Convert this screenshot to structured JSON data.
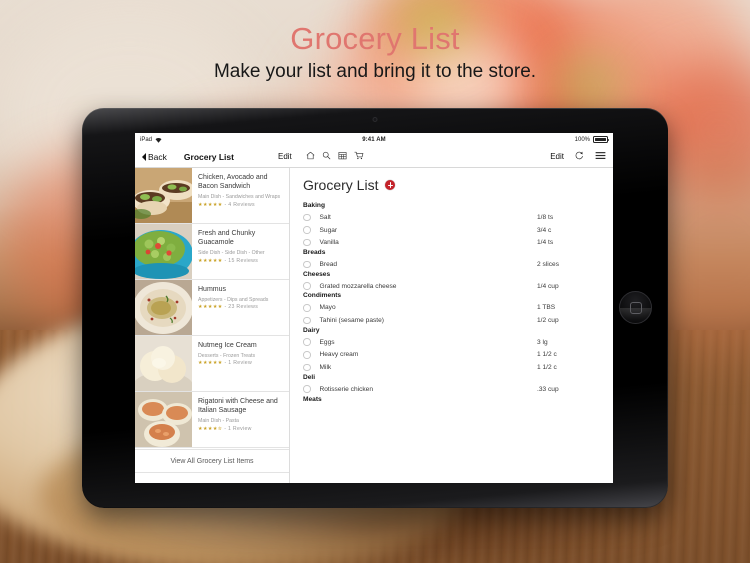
{
  "promo": {
    "title": "Grocery List",
    "subtitle": "Make your list and bring it to the store.",
    "title_color": "#e0766f"
  },
  "device": {
    "name": "ipad-mini",
    "orientation": "landscape"
  },
  "statusbar": {
    "device_label": "iPad",
    "wifi_icon": "wifi-icon",
    "time": "9:41 AM",
    "battery_percent": "100%",
    "battery_icon": "battery-full-icon"
  },
  "navbar": {
    "back_label": "Back",
    "back_icon": "chevron-left-icon",
    "title": "Grocery List",
    "edit_left_label": "Edit",
    "icons": [
      {
        "name": "home-icon",
        "glyph": "⌂"
      },
      {
        "name": "search-icon",
        "glyph": "⌕"
      },
      {
        "name": "calendar-icon",
        "glyph": "▦"
      },
      {
        "name": "shopping-cart-icon",
        "glyph": "🛒"
      }
    ],
    "edit_right_label": "Edit",
    "refresh_icon": "refresh-icon",
    "menu_icon": "hamburger-menu-icon"
  },
  "recipes": [
    {
      "name": "Chicken, Avocado and Bacon Sandwich",
      "category": "Main Dish - Sandwiches and Wraps",
      "stars": "★★★★★",
      "reviews": "- 4 Reviews",
      "thumb": "chicken-avocado-bacon-sandwich-photo"
    },
    {
      "name": "Fresh and Chunky Guacamole",
      "category": "Side Dish - Side Dish - Other",
      "stars": "★★★★★",
      "reviews": "- 15 Reviews",
      "thumb": "guacamole-photo"
    },
    {
      "name": "Hummus",
      "category": "Appetizers - Dips and Spreads",
      "stars": "★★★★★",
      "reviews": "- 23 Reviews",
      "thumb": "hummus-photo"
    },
    {
      "name": "Nutmeg Ice Cream",
      "category": "Desserts - Frozen Treats",
      "stars": "★★★★★",
      "reviews": "- 1 Review",
      "thumb": "nutmeg-ice-cream-photo"
    },
    {
      "name": "Rigatoni with Cheese and Italian Sausage",
      "category": "Main Dish - Pasta",
      "stars": "★★★★✮",
      "reviews": "- 1 Review",
      "thumb": "rigatoni-cheese-sausage-photo"
    }
  ],
  "view_all_label": "View All Grocery List Items",
  "grocery": {
    "title": "Grocery List",
    "add_button": "add-item-button",
    "accent_color": "#c4222a",
    "categories": [
      {
        "name": "Baking",
        "items": [
          {
            "name": "Salt",
            "qty": "1/8 ts"
          },
          {
            "name": "Sugar",
            "qty": "3/4 c"
          },
          {
            "name": "Vanilla",
            "qty": "1/4 ts"
          }
        ]
      },
      {
        "name": "Breads",
        "items": [
          {
            "name": "Bread",
            "qty": "2 slices"
          }
        ]
      },
      {
        "name": "Cheeses",
        "items": [
          {
            "name": "Grated mozzarella cheese",
            "qty": "1/4 cup"
          }
        ]
      },
      {
        "name": "Condiments",
        "items": [
          {
            "name": "Mayo",
            "qty": "1 TBS"
          },
          {
            "name": "Tahini (sesame paste)",
            "qty": "1/2 cup"
          }
        ]
      },
      {
        "name": "Dairy",
        "items": [
          {
            "name": "Eggs",
            "qty": "3 lg"
          },
          {
            "name": "Heavy cream",
            "qty": "1 1/2 c"
          },
          {
            "name": "Milk",
            "qty": "1 1/2 c"
          }
        ]
      },
      {
        "name": "Deli",
        "items": [
          {
            "name": "Rotisserie chicken",
            "qty": ".33 cup"
          }
        ]
      },
      {
        "name": "Meats",
        "items": []
      }
    ]
  }
}
